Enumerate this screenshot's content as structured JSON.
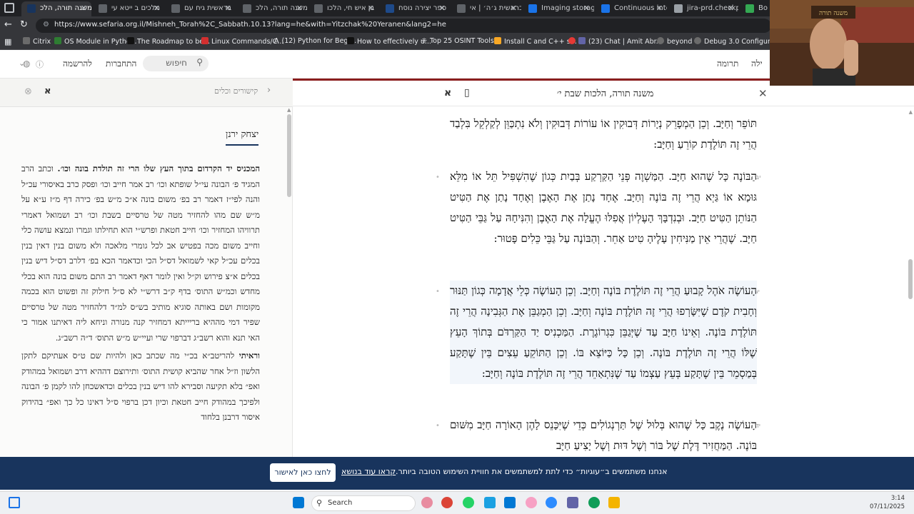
{
  "browser": {
    "tabs": [
      {
        "label": "משנה תורה, הלכ",
        "active": true
      },
      {
        "label": "מלכים ב ייטא עי",
        "active": false
      },
      {
        "label": "בראשית גיח עם",
        "active": false
      },
      {
        "label": "משנה תורה, הלכ",
        "active": false
      },
      {
        "label": "בן איש חי, הלכו",
        "active": false
      },
      {
        "label": "ספר יצירה נוסח",
        "active": false
      },
      {
        "label": "בראשית ג׳ה׳ | אי",
        "active": false
      },
      {
        "label": "Imaging storage",
        "active": false
      },
      {
        "label": "Continuous integ",
        "active": false
      },
      {
        "label": "jira-prd.checkpo",
        "active": false
      },
      {
        "label": "Bo",
        "active": false
      }
    ],
    "url": "https://www.sefaria.org.il/Mishneh_Torah%2C_Sabbath.10.13?lang=he&with=Yitzchak%20Yeranen&lang2=he",
    "bookmarks": [
      "Citrix",
      "OS Module in Pytho...",
      "The Roadmap to be...",
      "Linux Commands/C...",
      "(12) Python for Begi...",
      "How to effectively u...",
      "Top 25 OSINT Tools...",
      "Install C and C++ s...",
      "(23) Chat | Amit Abr...",
      "beyond",
      "Debug 3.0 Configur..."
    ]
  },
  "site_header": {
    "links": [
      "ילה",
      "תרומה"
    ],
    "search_label": "חיפוש",
    "update": "התחברות",
    "signup": "להרשמה"
  },
  "sidebar": {
    "back_label": "קישורים וכלים",
    "author_tab": "יצחק ירנן",
    "paragraphs": [
      {
        "bold": "המכניס יד הקרדום בתוך העץ שלו הרי זה תולדת בונה וכו׳.",
        "text": " וכתב הרב המגיד פ׳ הבונה עי״ל שופתא וכו׳ רב אמר חייב וכו׳ ופסק כרב באיסורי עכ״ל והנה לפי״ז דאמר רב בפ׳ משום בונה א״כ מ״ש בפ׳ כירה דף מ״ז ע״א על מ״ש שם מהו להחזיר מטה של טרסיים בשבת וכו׳ רב ושמואל דאמרי תרוויהו המחזיר וכו׳ חייב חטאת ופרש״י הוא תחילתו וגמרו ונמצא עושה כלי וחייב משום מכה בפטיש אב לכל גומרי מלאכה ולא משום בנין דאין בנין בכלים עכ״ל קאי לשמואל דס״ל הכי וכדאמר הכא בפ׳ דלרב דס״ל דיש בנין בכלים א״צ פירוש וק״ל ואין לומר דאף דאמר רב התם משום בונה הוא בכלי מחדש וכמ״ש התוס׳ בדף ק״ב דרש״י לא ס״ל חילוק זה ופשוט הוא בכמה מקומות ושם באותה סוגיא מותיב בש״ס למ״ד דלהחזיר מטה של טרסיים שפיר דמי מההיא בריייתא דמחזיר קנה מנורה וניחא ליה דאיתנו אמור כי האי תנא והוא רשב״ג דברפוי שרי ועיי״ש מ״ש התוס׳ ד״ה רשב״ג."
      },
      {
        "bold": "וראיתי",
        "text": " להריטב״א בכ״י מה שכתב כאן ולהיות שם ט״ס אעתיקם לתקן הלשון וז״ל אחר שהביא קושית התוס׳ ותירוצם דההיא דרב ושמואל במהודק ואפ״ בלא תקיעה וסבירא להו דיש בנין בכלים וכדאשכחן להו לקמן פ׳ הבונה ולפיכך במהודק חייב חטאת וכיון דכן ברפוי ס״ל דאינו כל כך ואפ״ בהידוק איסור דרבנן בלחוד"
      }
    ]
  },
  "reader": {
    "title": "משנה תורה, הלכות שבת י׳",
    "segments": [
      {
        "num": "",
        "text": "תּוֹפֵר וְחַיָּב. וְכֵן הַמְפָרֵק נְיָרוֹת דְּבוּקִין אוֹ עוֹרוֹת דְּבוּקִין וְלֹא נִתְכַּוֵּן לְקַלְקֵל בִּלְבַד הֲרֵי זֶה תּוֹלֶדֶת קוֹרֵעַ וְחַיָּב:"
      },
      {
        "num": "יב",
        "text": "הַבּוֹנֶה כָּל שֶׁהוּא חַיָּב. הַמַּשְׁוֶה פְּנֵי הַקַּרְקַע בְּבַיִת כְּגוֹן שֶׁהִשְׁפִּיל תֵּל אוֹ מִלֵּא גּוּמָא אוֹ גַּיְא הֲרֵי זֶה בּוֹנֶה וְחַיָּב. אֶחָד נָתַן אֶת הָאֶבֶן וְאֶחָד נָתַן אֶת הַטִּיט הַנּוֹתֵן הַטִּיט חַיָּב. וּבְנִדְבָּךְ הָעֶלְיוֹן אֲפִלּוּ הֶעֱלָה אֶת הָאֶבֶן וְהִנִּיחָהּ עַל גַּבֵּי הַטִּיט חַיָּב. שֶׁהֲרֵי אֵין מַנִּיחִין עָלֶיהָ טִיט אַחֵר. וְהַבּוֹנֶה עַל גַּבֵּי כֵּלִים פָּטוּר:"
      },
      {
        "num": "יג",
        "text": "הָעוֹשֶׂה אֹהֶל קָבוּעַ הֲרֵי זֶה תּוֹלֶדֶת בּוֹנֶה וְחַיָּב. וְכֵן הָעוֹשֶׂה כְּלֵי אֲדָמָה כְּגוֹן תַּנּוּר וְחָבִית קֹדֶם שֶׁיִּשָּׂרְפוּ הֲרֵי זֶה תּוֹלֶדֶת בּוֹנֶה וְחַיָּב. וְכֵן הַמְגַבֵּן אֶת הַגְּבִינָה הֲרֵי זֶה תּוֹלֶדֶת בּוֹנֶה. וְאֵינוֹ חַיָּב עַד שֶׁיְּגַבֵּן כִּגְרוֹגֶרֶת. הַמַּכְנִיס יַד הַקַּרְדֹּם בְּתוֹךְ הָעֵץ שֶׁלּוֹ הֲרֵי זֶה תּוֹלֶדֶת בּוֹנֶה. וְכֵן כָּל כַּיּוֹצֵא בּוֹ. וְכֵן הַתּוֹקֵעַ עֵצִים בֵּין שֶׁתָּקַע בְּמַסְמֵר בֵּין שֶׁתָּקַע בְּעֵץ עַצְמוֹ עַד שֶׁנִּתְאַחֵד הֲרֵי זֶה תּוֹלֶדֶת בּוֹנֶה וְחַיָּב:"
      },
      {
        "num": "יד",
        "text": "הָעוֹשֶׂה נֶקֶב כָּל שֶׁהוּא בְּלוּל שֶׁל תַּרְנְגוֹלִים כְּדֵי שֶׁיִּכָּנֵס לָהֶן הָאוֹרָה חַיָּב מִשּׁוּם בּוֹנֶה. הַמַּחֲזִיר דֶּלֶת שֶׁל בּוֹר וְשֶׁל דּוּת וְשֶׁל יָצִיעַ חַיָּב"
      }
    ]
  },
  "cookie": {
    "message": "אנחנו משתמשים ב״עוגיות״ כדי לתת למשתמשים את חוויית השימוש הטובה ביותר.",
    "more": "קראו עוד בנושא",
    "button": "לחצו כאן לאישור"
  },
  "taskbar": {
    "search": "Search",
    "time": "3:14",
    "date": "07/11/2025"
  },
  "webcam": {
    "shelf_label": "משנה תורה"
  },
  "colors": {
    "brand_navy": "#18345d",
    "brand_red": "#8b1e1e"
  }
}
